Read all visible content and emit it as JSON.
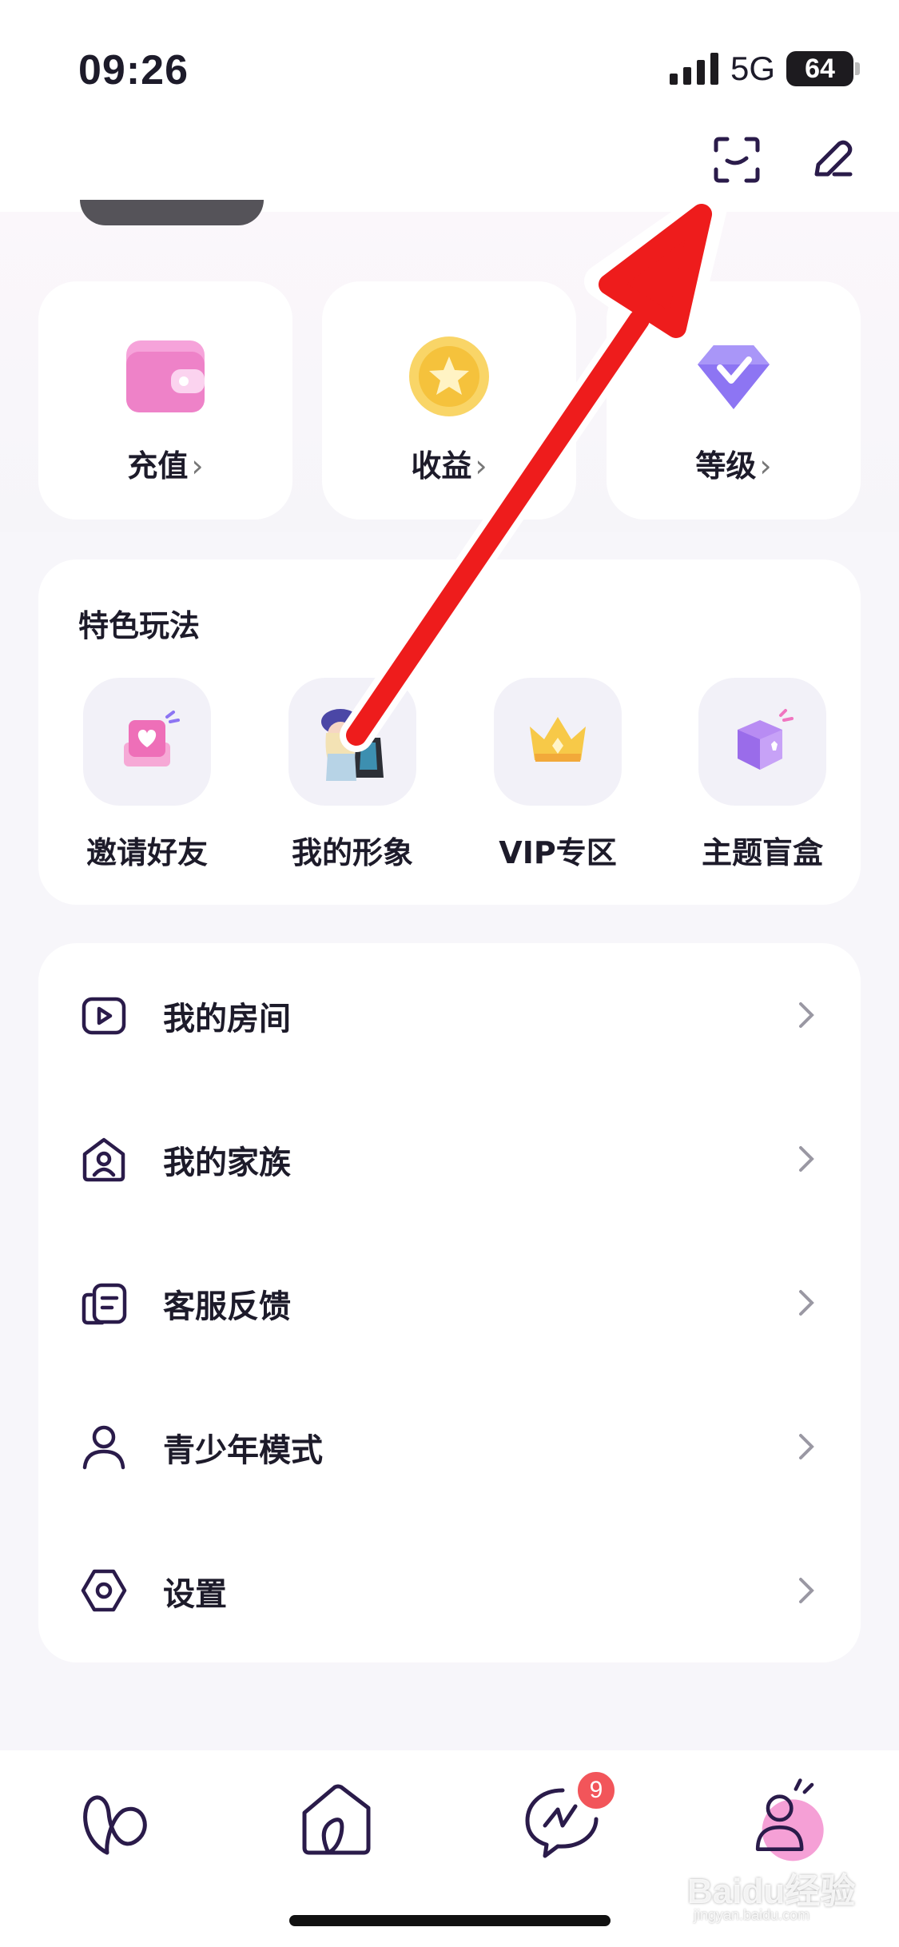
{
  "status_bar": {
    "time": "09:26",
    "network": "5G",
    "battery": "64"
  },
  "quick_actions": [
    {
      "label": "充值",
      "chevron": "›",
      "icon": "wallet-icon",
      "color": "#f28fcf"
    },
    {
      "label": "收益",
      "chevron": "›",
      "icon": "star-coin-icon",
      "color": "#f8cf55"
    },
    {
      "label": "等级",
      "chevron": "›",
      "icon": "diamond-badge-icon",
      "color": "#8b73f2"
    }
  ],
  "features": {
    "title": "特色玩法",
    "items": [
      {
        "label": "邀请好友",
        "icon": "invite-heart-icon"
      },
      {
        "label": "我的形象",
        "icon": "avatar-figure-icon"
      },
      {
        "label": "VIP专区",
        "icon": "crown-icon"
      },
      {
        "label": "主题盲盒",
        "icon": "blind-box-icon"
      }
    ]
  },
  "menu": [
    {
      "label": "我的房间",
      "icon": "room-play-icon"
    },
    {
      "label": "我的家族",
      "icon": "family-house-icon"
    },
    {
      "label": "客服反馈",
      "icon": "feedback-card-icon"
    },
    {
      "label": "青少年模式",
      "icon": "person-icon"
    },
    {
      "label": "设置",
      "icon": "settings-hex-icon"
    }
  ],
  "tabbar": {
    "items": [
      "heart-tab-icon",
      "home-tab-icon",
      "messages-tab-icon",
      "profile-tab-icon"
    ],
    "message_badge": "9"
  },
  "watermark": {
    "main": "Baidu经验",
    "sub": "jingyan.baidu.com"
  },
  "colors": {
    "accent": "#2a1b4a",
    "arrow": "#ee1c1c",
    "badge": "#f2555a",
    "pink": "#f5a0d6"
  }
}
